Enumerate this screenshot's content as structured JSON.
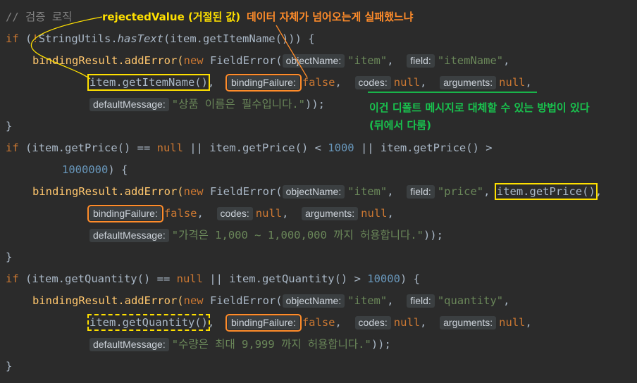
{
  "code": {
    "comment": "// 검증 로직",
    "if1_kw": "if",
    "if1_cond_a": " (",
    "if1_bang": "!",
    "if1_utils": "StringUtils.",
    "if1_hastext": "hasText",
    "if1_rest": "(item.getItemName())) {",
    "add1_pre": "bindingResult.addError(",
    "new_kw": "new",
    "fielderror": " FieldError(",
    "hint_objectName": "objectName:",
    "str_item": "\"item\"",
    "hint_field": "field:",
    "str_itemName": "\"itemName\"",
    "comma": ",",
    "getItemName": "item.getItemName()",
    "hint_bindingFailure": "bindingFailure:",
    "false_kw": "false",
    "hint_codes": "codes:",
    "null_kw": "null",
    "hint_arguments": "arguments:",
    "hint_defaultMessage": "defaultMessage:",
    "msg1": "\"상품 이름은 필수입니다.\"",
    "close_paren": "));",
    "brace_close": "}",
    "if2_a": " (item.getPrice() == ",
    "or_a": " || item.getPrice() < ",
    "num_1000": "1000",
    "or_b": " || item.getPrice() >",
    "num_1000000": "1000000",
    "brace_open": ") {",
    "str_price": "\"price\"",
    "getPrice": "item.getPrice()",
    "msg2": "\"가격은 1,000 ~ 1,000,000 까지 허용합니다.\"",
    "if3_a": " (item.getQuantity() == ",
    "or_c": " || item.getQuantity() > ",
    "num_10000": "10000",
    "str_quantity": "\"quantity\"",
    "getQuantity": "item.getQuantity()",
    "msg3": "\"수량은 최대 9,999 까지 허용합니다.\""
  },
  "annotations": {
    "rejected": "rejectedValue (거절된 값)",
    "binding_fail": "데이터 자체가 넘어오는게 실패했느냐",
    "default_msg_1": "이건 디폴트 메시지로 대체할 수 있는 방법이 있다",
    "default_msg_2": "(뒤에서 다룸)"
  }
}
